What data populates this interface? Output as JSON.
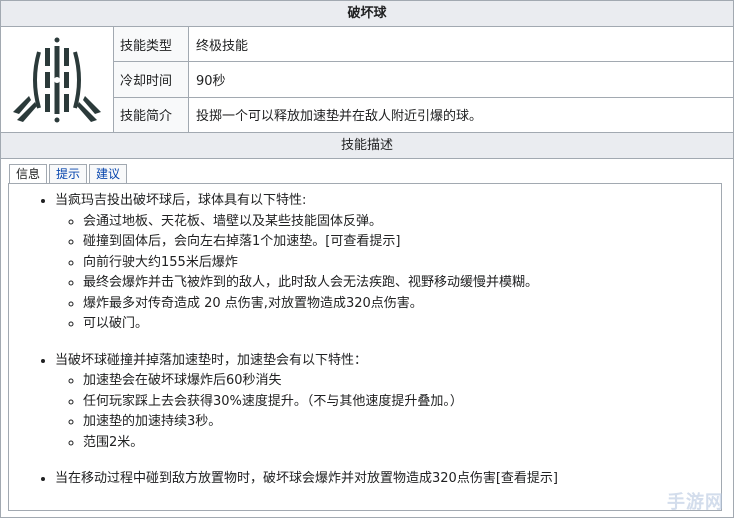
{
  "title": "破坏球",
  "rows": [
    {
      "label": "技能类型",
      "value": "终极技能"
    },
    {
      "label": "冷却时间",
      "value": "90秒"
    },
    {
      "label": "技能简介",
      "value": "投掷一个可以释放加速垫并在敌人附近引爆的球。"
    }
  ],
  "section_title": "技能描述",
  "tabs": [
    "信息",
    "提示",
    "建议"
  ],
  "groups": [
    {
      "heading": "当疯玛吉投出破坏球后，球体具有以下特性:",
      "items": [
        "会通过地板、天花板、墙壁以及某些技能固体反弹。",
        "碰撞到固体后，会向左右掉落1个加速垫。[可查看提示]",
        "向前行驶大约155米后爆炸",
        "最终会爆炸并击飞被炸到的敌人，此时敌人会无法疾跑、视野移动缓慢并模糊。",
        "爆炸最多对传奇造成 20 点伤害,对放置物造成320点伤害。",
        "可以破门。"
      ]
    },
    {
      "heading": "当破坏球碰撞并掉落加速垫时，加速垫会有以下特性：",
      "items": [
        "加速垫会在破坏球爆炸后60秒消失",
        "任何玩家踩上去会获得30%速度提升。（不与其他速度提升叠加。）",
        "加速垫的加速持续3秒。",
        "范围2米。"
      ]
    }
  ],
  "final_line": "当在移动过程中碰到敌方放置物时，破坏球会爆炸并对放置物造成320点伤害[查看提示]",
  "watermark": "手游网",
  "icon": "wrecking-ball-skill-icon",
  "colors": {
    "border": "#a2a9b1",
    "header_bg": "#eaecf0",
    "link": "#0645ad",
    "icon": "#2b3a3a"
  }
}
